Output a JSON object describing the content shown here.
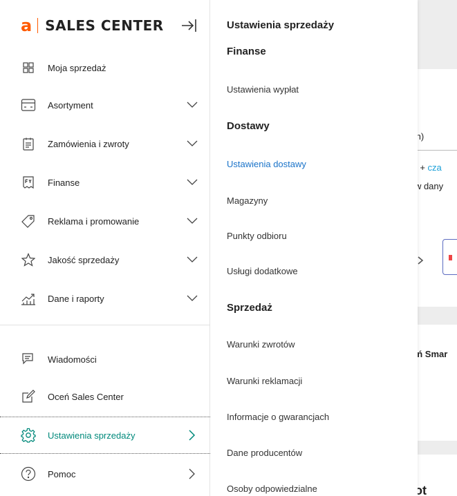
{
  "brand": {
    "logo_letter": "a",
    "name": "SALES CENTER",
    "accent": "#ff5a00"
  },
  "sidebar": {
    "items": [
      {
        "label": "Moja sprzedaż",
        "icon": "grid-icon",
        "has_chevron": false
      },
      {
        "label": "Asortyment",
        "icon": "inventory-icon",
        "has_chevron": true
      },
      {
        "label": "Zamówienia i zwroty",
        "icon": "clipboard-icon",
        "has_chevron": true
      },
      {
        "label": "Finanse",
        "icon": "invoice-icon",
        "has_chevron": true
      },
      {
        "label": "Reklama i promowanie",
        "icon": "tag-icon",
        "has_chevron": true
      },
      {
        "label": "Jakość sprzedaży",
        "icon": "star-icon",
        "has_chevron": true
      },
      {
        "label": "Dane i raporty",
        "icon": "chart-icon",
        "has_chevron": true
      },
      {
        "label": "Wiadomości",
        "icon": "chat-icon",
        "has_chevron": false
      },
      {
        "label": "Oceń Sales Center",
        "icon": "edit-icon",
        "has_chevron": false
      },
      {
        "label": "Ustawienia sprzedaży",
        "icon": "gear-icon",
        "has_chevron": true,
        "active": true
      },
      {
        "label": "Pomoc",
        "icon": "help-icon",
        "has_chevron": true
      }
    ],
    "active_color": "#00897b"
  },
  "submenu": {
    "title": "Ustawienia sprzedaży",
    "sections": [
      {
        "heading": "Finanse",
        "links": [
          "Ustawienia wypłat"
        ]
      },
      {
        "heading": "Dostawy",
        "links": [
          "Ustawienia dostawy",
          "Magazyny",
          "Punkty odbioru",
          "Usługi dodatkowe"
        ]
      },
      {
        "heading": "Sprzedaż",
        "links": [
          "Warunki zwrotów",
          "Warunki reklamacji",
          "Informacje o gwarancjach",
          "Dane producentów",
          "Osoby odpowiedzialne"
        ]
      }
    ],
    "active_link": "Ustawienia dostawy",
    "active_color": "#1a73c9"
  },
  "background": {
    "input_fragment": ":h)",
    "line1_fragment": "ki) + ",
    "line1_link": "cza",
    "line2_fragment": ") w dany",
    "arrow": "›",
    "bold_fragment": "ań Smar",
    "bottom_fragment": "ot"
  }
}
